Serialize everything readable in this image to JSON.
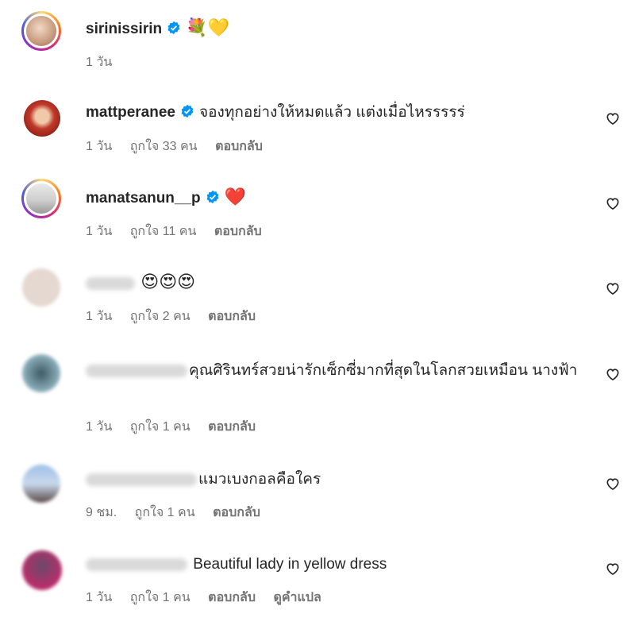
{
  "comments": [
    {
      "username": "sirinissirin",
      "text": "💐💛",
      "time": "1 วัน",
      "likes": "",
      "reply": "",
      "translate": ""
    },
    {
      "username": "mattperanee",
      "text": "จองทุกอย่างให้หมดแล้ว แต่งเมื่อไหรรรรร่",
      "time": "1 วัน",
      "likes": "ถูกใจ 33 คน",
      "reply": "ตอบกลับ",
      "translate": ""
    },
    {
      "username": "manatsanun__p",
      "text": "❤️",
      "time": "1 วัน",
      "likes": "ถูกใจ 11 คน",
      "reply": "ตอบกลับ",
      "translate": ""
    },
    {
      "username": "",
      "text": "😍😍😍",
      "time": "1 วัน",
      "likes": "ถูกใจ 2 คน",
      "reply": "ตอบกลับ",
      "translate": ""
    },
    {
      "username": "",
      "text": "คุณศิรินทร์สวยน่ารักเซ็กซี่มากที่สุดในโลกสวยเหมือน นางฟ้า",
      "time": "1 วัน",
      "likes": "ถูกใจ 1 คน",
      "reply": "ตอบกลับ",
      "translate": ""
    },
    {
      "username": "",
      "text": "แมวเบงกอลคือใคร",
      "time": "9 ชม.",
      "likes": "ถูกใจ 1 คน",
      "reply": "ตอบกลับ",
      "translate": ""
    },
    {
      "username": "",
      "text": "Beautiful lady in yellow dress",
      "time": "1 วัน",
      "likes": "ถูกใจ 1 คน",
      "reply": "ตอบกลับ",
      "translate": "ดูคำแปล"
    }
  ],
  "colors": {
    "verified_blue": "#0095f6",
    "meta_gray": "#737373",
    "text": "#262626"
  },
  "icons": {
    "verified": "verified-badge-icon",
    "like": "heart-outline-icon"
  }
}
